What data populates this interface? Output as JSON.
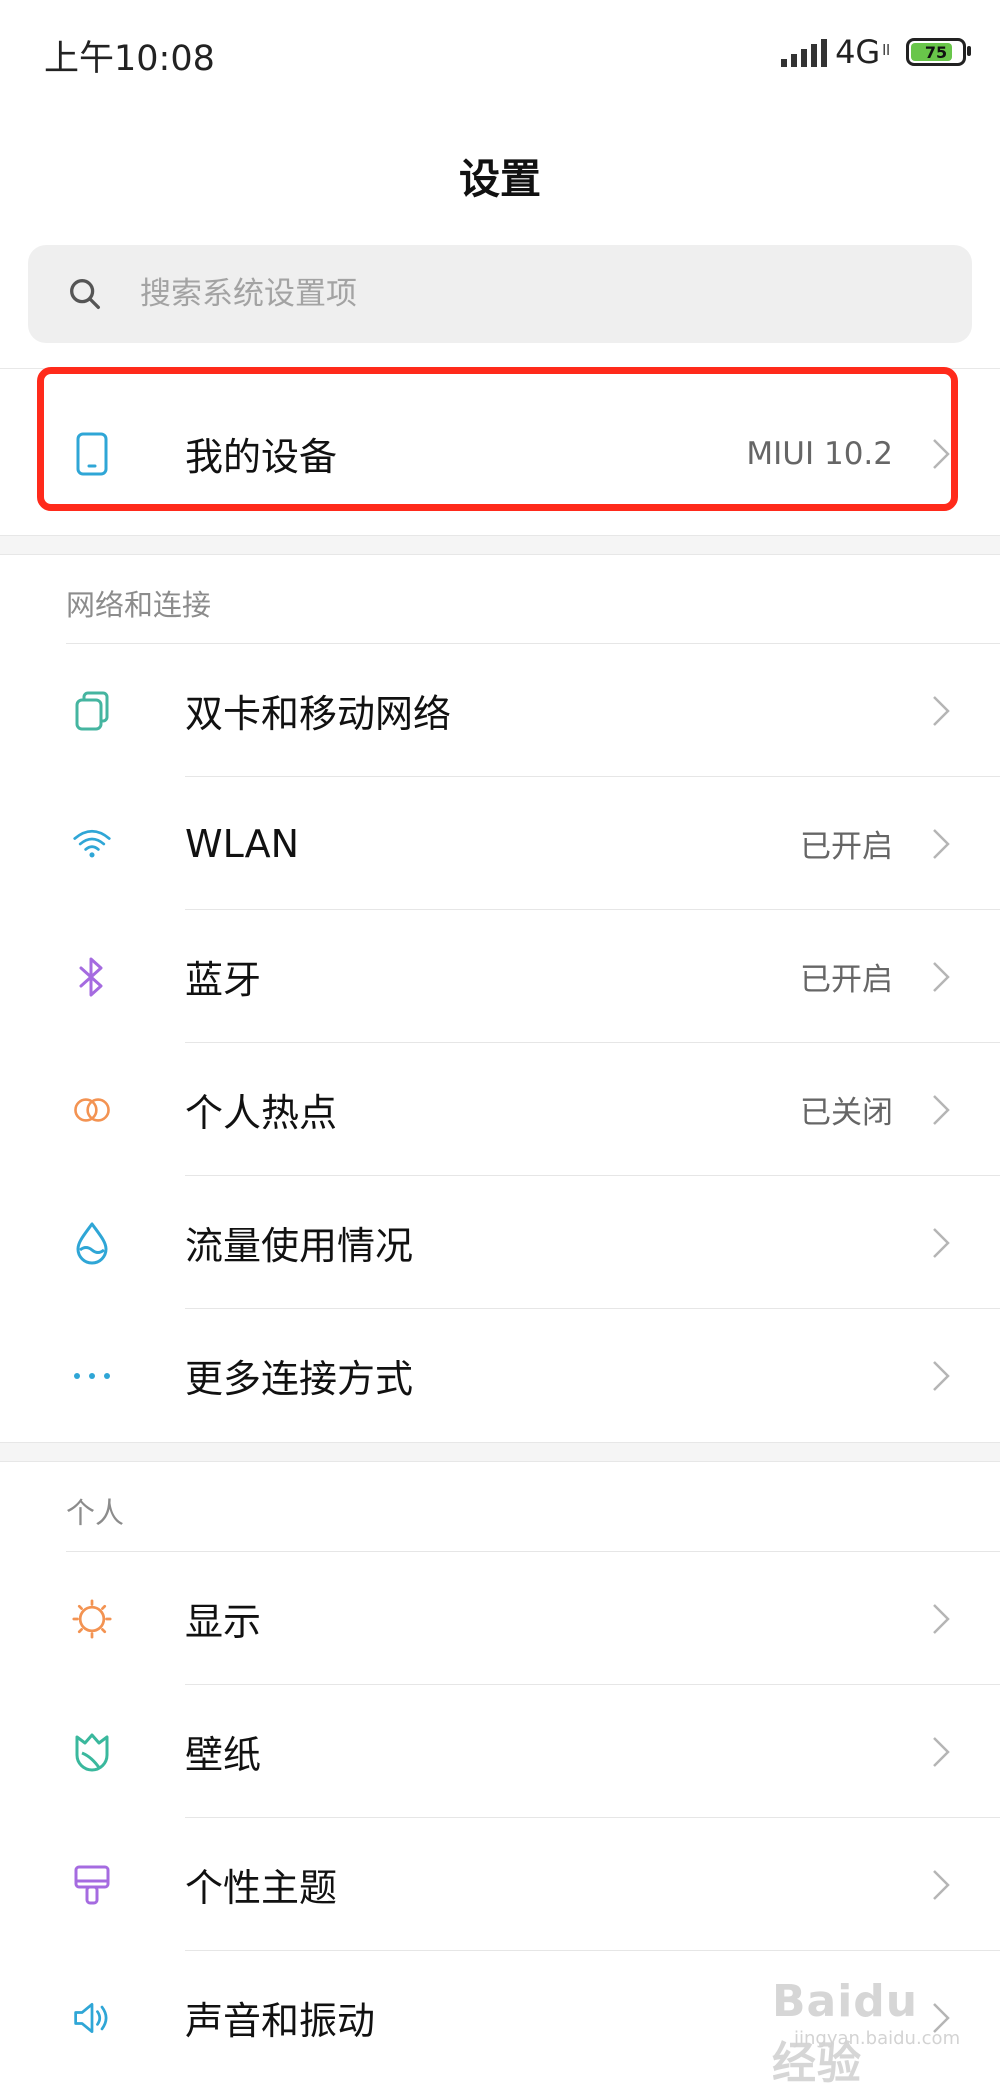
{
  "status_bar": {
    "time": "上午10:08",
    "network": "4G",
    "network_sub": "ll",
    "battery": "75"
  },
  "header": {
    "title": "设置"
  },
  "search": {
    "placeholder": "搜索系统设置项"
  },
  "device": {
    "label": "我的设备",
    "value": "MIUI 10.2",
    "icon": "phone-icon"
  },
  "sections": [
    {
      "title": "网络和连接",
      "items": [
        {
          "label": "双卡和移动网络",
          "value": "",
          "icon": "dual-sim-icon",
          "color": "#45b5a0"
        },
        {
          "label": "WLAN",
          "value": "已开启",
          "icon": "wifi-icon",
          "color": "#2fa6d6"
        },
        {
          "label": "蓝牙",
          "value": "已开启",
          "icon": "bluetooth-icon",
          "color": "#a56be0"
        },
        {
          "label": "个人热点",
          "value": "已关闭",
          "icon": "hotspot-icon",
          "color": "#f39352"
        },
        {
          "label": "流量使用情况",
          "value": "",
          "icon": "data-usage-icon",
          "color": "#2fa6d6"
        },
        {
          "label": "更多连接方式",
          "value": "",
          "icon": "more-icon",
          "color": "#2fa6d6"
        }
      ]
    },
    {
      "title": "个人",
      "items": [
        {
          "label": "显示",
          "value": "",
          "icon": "display-icon",
          "color": "#f39352"
        },
        {
          "label": "壁纸",
          "value": "",
          "icon": "wallpaper-icon",
          "color": "#3ab89d"
        },
        {
          "label": "个性主题",
          "value": "",
          "icon": "theme-icon",
          "color": "#a56be0"
        },
        {
          "label": "声音和振动",
          "value": "",
          "icon": "sound-icon",
          "color": "#2fa6d6"
        }
      ]
    }
  ],
  "watermark": {
    "text": "Baidu 经验",
    "sub": "jingyan.baidu.com"
  },
  "colors": {
    "highlight": "#ff2a1b",
    "search_bg": "#efefef"
  }
}
